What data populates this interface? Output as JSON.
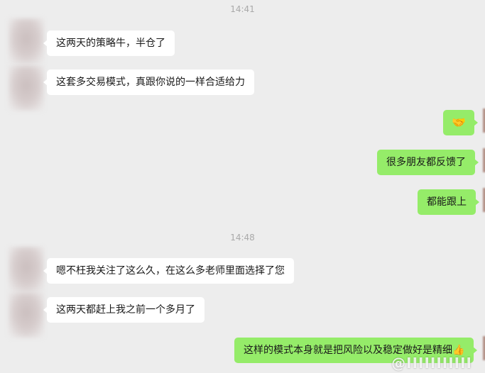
{
  "timestamps": [
    "14:41",
    "14:48"
  ],
  "messages": [
    {
      "side": "in",
      "text": "这两天的策略牛，半仓了"
    },
    {
      "side": "in",
      "text": "这套多交易模式，真跟你说的一样合适给力"
    },
    {
      "side": "out",
      "emoji": "🤝"
    },
    {
      "side": "out",
      "text": "很多朋友都反馈了"
    },
    {
      "side": "out",
      "text": "都能跟上"
    },
    {
      "side": "in",
      "text": "嗯不枉我关注了这么久，在这么多老师里面选择了您"
    },
    {
      "side": "in",
      "text": "这两天都赶上我之前一个多月了"
    },
    {
      "side": "out",
      "text": "这样的模式本身就是把风险以及稳定做好是精细👍"
    }
  ],
  "watermark": "@IIIIIIIIIII",
  "colors": {
    "background": "#ededed",
    "outgoing_bubble": "#95ec69",
    "incoming_bubble": "#ffffff",
    "timestamp": "#a9a9a9"
  }
}
